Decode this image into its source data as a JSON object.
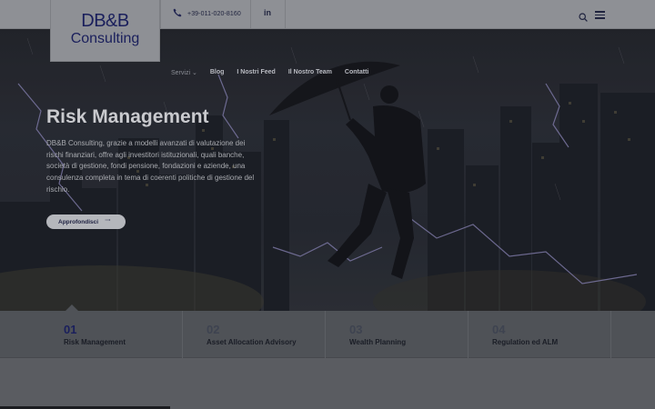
{
  "brand": {
    "line1": "DB&B",
    "line2": "Consulting"
  },
  "topbar": {
    "phone": "+39-011-020-8160",
    "linkedin": "in"
  },
  "nav": [
    {
      "label": "Servizi"
    },
    {
      "label": "Blog"
    },
    {
      "label": "I Nostri Feed"
    },
    {
      "label": "Il Nostro Team"
    },
    {
      "label": "Contatti"
    }
  ],
  "hero": {
    "title": "Risk Management",
    "text": "DB&B Consulting, grazie a modelli avanzati di valutazione dei rischi finanziari, offre agli investitori istituzionali, quali banche, società di gestione, fondi pensione, fondazioni e aziende, una consulenza completa in tema di coerenti politiche di gestione del rischio.",
    "cta": "Approfondisci"
  },
  "tabs": [
    {
      "num": "01",
      "label": "Risk Management"
    },
    {
      "num": "02",
      "label": "Asset Allocation Advisory"
    },
    {
      "num": "03",
      "label": "Wealth Planning"
    },
    {
      "num": "04",
      "label": "Regulation ed ALM"
    }
  ],
  "slider": {
    "progress": 0.26
  },
  "colors": {
    "brand": "#1a1f5c",
    "overlay": "#5a5c61"
  }
}
